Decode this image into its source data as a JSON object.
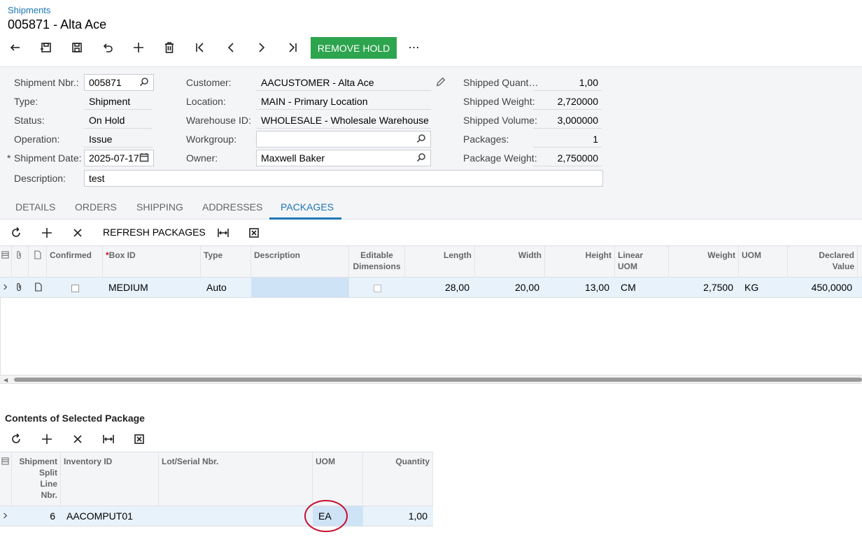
{
  "header": {
    "breadcrumb": "Shipments",
    "title": "005871 - Alta Ace",
    "remove_hold_label": "REMOVE HOLD",
    "more_label": "⋯",
    "accent_color": "#2da44e"
  },
  "form": {
    "shipment_nbr_label": "Shipment Nbr.:",
    "shipment_nbr": "005871",
    "type_label": "Type:",
    "type": "Shipment",
    "status_label": "Status:",
    "status": "On Hold",
    "operation_label": "Operation:",
    "operation": "Issue",
    "shipment_date_label": "Shipment Date:",
    "shipment_date_req": "*",
    "shipment_date": "2025-07-17",
    "description_label": "Description:",
    "description": "test",
    "customer_label": "Customer:",
    "customer": "AACUSTOMER - Alta Ace",
    "location_label": "Location:",
    "location": "MAIN - Primary Location",
    "warehouse_label": "Warehouse ID:",
    "warehouse": "WHOLESALE - Wholesale Warehouse",
    "workgroup_label": "Workgroup:",
    "workgroup": "",
    "owner_label": "Owner:",
    "owner": "Maxwell Baker",
    "shipped_qty_label": "Shipped Quant…",
    "shipped_qty": "1,00",
    "shipped_weight_label": "Shipped Weight:",
    "shipped_weight": "2,720000",
    "shipped_volume_label": "Shipped Volume:",
    "shipped_volume": "3,000000",
    "packages_label": "Packages:",
    "packages": "1",
    "package_weight_label": "Package Weight:",
    "package_weight": "2,750000"
  },
  "tabs": {
    "details": "DETAILS",
    "orders": "ORDERS",
    "shipping": "SHIPPING",
    "addresses": "ADDRESSES",
    "packages": "PACKAGES",
    "active": "PACKAGES"
  },
  "packages_grid": {
    "refresh_label": "REFRESH PACKAGES",
    "headers": {
      "confirmed": "Confirmed",
      "box_req": "*",
      "box_id": "Box ID",
      "type": "Type",
      "description": "Description",
      "editable1": "Editable",
      "editable2": "Dimensions",
      "length": "Length",
      "width": "Width",
      "height": "Height",
      "linear1": "Linear",
      "linear2": "UOM",
      "weight": "Weight",
      "uom": "UOM",
      "declared1": "Declared",
      "declared2": "Value"
    },
    "rows": [
      {
        "box_id": "MEDIUM",
        "type": "Auto",
        "description": "",
        "length": "28,00",
        "width": "20,00",
        "height": "13,00",
        "linear_uom": "CM",
        "weight": "2,7500",
        "uom": "KG",
        "declared_value": "450,0000"
      }
    ]
  },
  "contents": {
    "title": "Contents of Selected Package",
    "headers": {
      "line1": "Shipment",
      "line2": "Split",
      "line3": "Line",
      "line4": "Nbr.",
      "inventory_id": "Inventory ID",
      "lot_serial": "Lot/Serial Nbr.",
      "uom": "UOM",
      "quantity": "Quantity"
    },
    "rows": [
      {
        "split_line": "6",
        "inventory_id": "AACOMPUT01",
        "lot_serial": "",
        "uom": "EA",
        "quantity": "1,00"
      }
    ],
    "highlight_color": "#c8102e"
  }
}
